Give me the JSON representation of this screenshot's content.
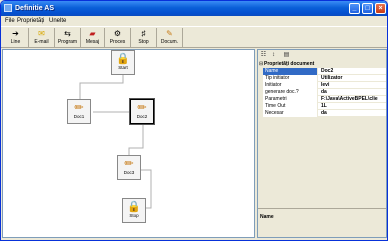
{
  "window": {
    "title": "Definitie AS"
  },
  "menu": {
    "items": [
      "File",
      "Proprietăți",
      "Unelte"
    ]
  },
  "toolbar": {
    "tools": [
      {
        "label": "Line",
        "icon": "line-icon"
      },
      {
        "label": "E-mail",
        "icon": "email-icon"
      },
      {
        "label": "Program",
        "icon": "program-icon"
      },
      {
        "label": "Mesaj",
        "icon": "message-icon"
      },
      {
        "label": "Proces",
        "icon": "process-icon"
      },
      {
        "label": "Stop",
        "icon": "stop-icon"
      },
      {
        "label": "Docum.",
        "icon": "document-icon"
      }
    ]
  },
  "canvas": {
    "nodes": [
      {
        "label": "Start",
        "icon": "lock-icon"
      },
      {
        "label": "Doc1",
        "icon": "pencil-icon"
      },
      {
        "label": "Doc2",
        "icon": "pencil-icon"
      },
      {
        "label": "Doc3",
        "icon": "pencil-icon"
      },
      {
        "label": "Stop",
        "icon": "lock-icon"
      }
    ]
  },
  "properties": {
    "category": "Proprietăți document",
    "rows": [
      {
        "key": "Name",
        "value": "Doc2"
      },
      {
        "key": "Tip initiator",
        "value": "Utilizator"
      },
      {
        "key": "Initiator",
        "value": "levi"
      },
      {
        "key": "generare doc.?",
        "value": "da"
      },
      {
        "key": "Parametri",
        "value": "F:\\Java\\ActiveBPEL\\clie"
      },
      {
        "key": "Time Out",
        "value": "1L"
      },
      {
        "key": "Necesar",
        "value": "da"
      }
    ],
    "description_title": "Name"
  }
}
